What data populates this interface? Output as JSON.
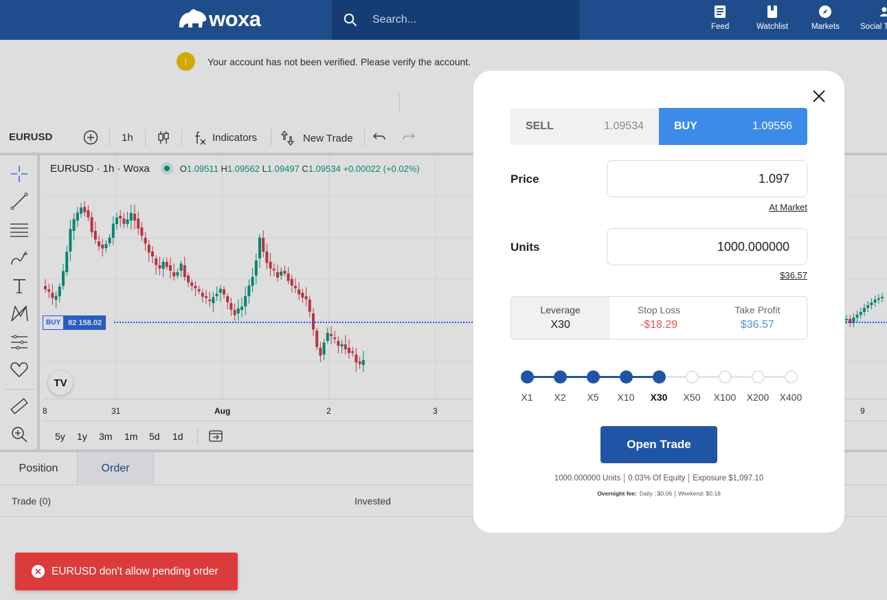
{
  "header": {
    "logo_text": "woxa",
    "search_placeholder": "Search...",
    "nav": [
      {
        "label": "Feed",
        "icon": "feed-icon"
      },
      {
        "label": "Watchlist",
        "icon": "bookmark-icon"
      },
      {
        "label": "Markets",
        "icon": "compass-icon"
      },
      {
        "label": "Social T",
        "icon": "users-icon"
      }
    ]
  },
  "notice": {
    "icon_glyph": "!",
    "text": "Your account has not been verified. Please verify the account."
  },
  "toolbar": {
    "symbol": "EURUSD",
    "interval": "1h",
    "indicators_label": "Indicators",
    "new_trade_label": "New Trade"
  },
  "chart": {
    "legend_title": "EURUSD · 1h · Woxa",
    "ohlc": {
      "o_label": "O",
      "o": "1.09511",
      "h_label": "H",
      "h": "1.09562",
      "l_label": "L",
      "l": "1.09497",
      "c_label": "C",
      "c": "1.09534",
      "change": "+0.00022 (+0.02%)"
    },
    "buy_line": {
      "side": "BUY",
      "value": "82 158.02"
    },
    "x_ticks": [
      "8",
      "31",
      "Aug",
      "2",
      "3",
      "9"
    ],
    "ranges": [
      "5y",
      "1y",
      "3m",
      "1m",
      "5d",
      "1d"
    ],
    "tv_logo": "TV",
    "colors": {
      "up": "#089981",
      "down": "#d13d4a"
    }
  },
  "panel": {
    "tabs": [
      "Position",
      "Order"
    ],
    "columns": [
      "Trade (0)",
      "Invested"
    ]
  },
  "modal": {
    "sell": {
      "label": "SELL",
      "price": "1.09534"
    },
    "buy": {
      "label": "BUY",
      "price": "1.09556"
    },
    "price": {
      "label": "Price",
      "value": "1.097",
      "link": "At Market"
    },
    "units": {
      "label": "Units",
      "value": "1000.000000",
      "link": "$36.57"
    },
    "leverage": {
      "label": "Leverage",
      "value": "X30"
    },
    "stop_loss": {
      "label": "Stop Loss",
      "value": "-$18.29"
    },
    "take_profit": {
      "label": "Take Profit",
      "value": "$36.57"
    },
    "leverage_options": [
      "X1",
      "X2",
      "X5",
      "X10",
      "X30",
      "X50",
      "X100",
      "X200",
      "X400"
    ],
    "leverage_selected_index": 4,
    "open_button": "Open Trade",
    "summary": {
      "units": "1000.000000 Units",
      "equity": "0.03% Of Equity",
      "exposure": "Exposure $1,097.10"
    },
    "fees": {
      "label": "Overnight fee:",
      "daily": "Daily : $0.06",
      "weekend": "Weekend: $0.18"
    }
  },
  "toast": {
    "message": "EURUSD don't allow pending order"
  }
}
